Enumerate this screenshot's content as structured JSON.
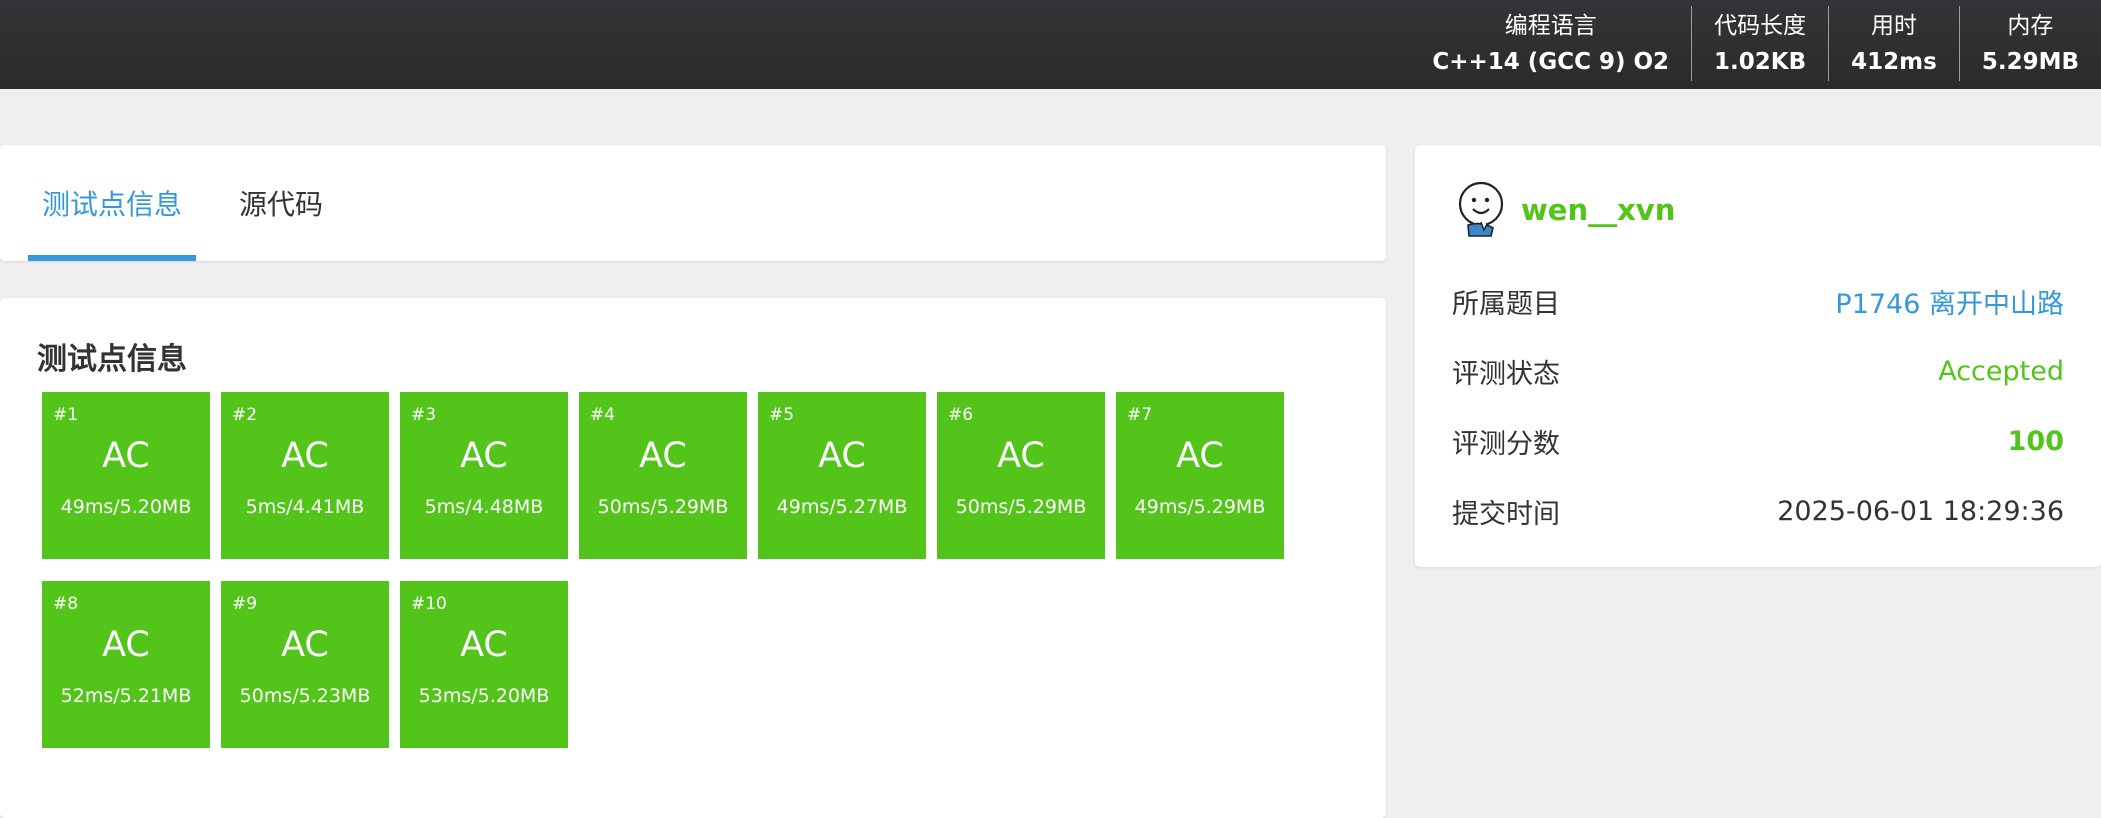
{
  "header": {
    "stats": [
      {
        "label": "编程语言",
        "value": "C++14 (GCC 9) O2"
      },
      {
        "label": "代码长度",
        "value": "1.02KB"
      },
      {
        "label": "用时",
        "value": "412ms"
      },
      {
        "label": "内存",
        "value": "5.29MB"
      }
    ]
  },
  "tabs": {
    "active": "测试点信息",
    "code": "源代码"
  },
  "tests": {
    "title": "测试点信息",
    "color": "#52c41a",
    "cases": [
      {
        "num": "#1",
        "result": "AC",
        "info": "49ms/5.20MB"
      },
      {
        "num": "#2",
        "result": "AC",
        "info": "5ms/4.41MB"
      },
      {
        "num": "#3",
        "result": "AC",
        "info": "5ms/4.48MB"
      },
      {
        "num": "#4",
        "result": "AC",
        "info": "50ms/5.29MB"
      },
      {
        "num": "#5",
        "result": "AC",
        "info": "49ms/5.27MB"
      },
      {
        "num": "#6",
        "result": "AC",
        "info": "50ms/5.29MB"
      },
      {
        "num": "#7",
        "result": "AC",
        "info": "49ms/5.29MB"
      },
      {
        "num": "#8",
        "result": "AC",
        "info": "52ms/5.21MB"
      },
      {
        "num": "#9",
        "result": "AC",
        "info": "50ms/5.23MB"
      },
      {
        "num": "#10",
        "result": "AC",
        "info": "53ms/5.20MB"
      }
    ]
  },
  "sidebar": {
    "username": "wen__xvn",
    "avatar_icon": "cartoon-face-avatar",
    "rows": [
      {
        "key": "所属题目",
        "value": "P1746 离开中山路"
      },
      {
        "key": "评测状态",
        "value": "Accepted"
      },
      {
        "key": "评测分数",
        "value": "100"
      },
      {
        "key": "提交时间",
        "value": "2025-06-01 18:29:36"
      }
    ]
  },
  "colors": {
    "accent": "#3498db",
    "success": "#52c41a",
    "header_bg": "#2f3033"
  }
}
